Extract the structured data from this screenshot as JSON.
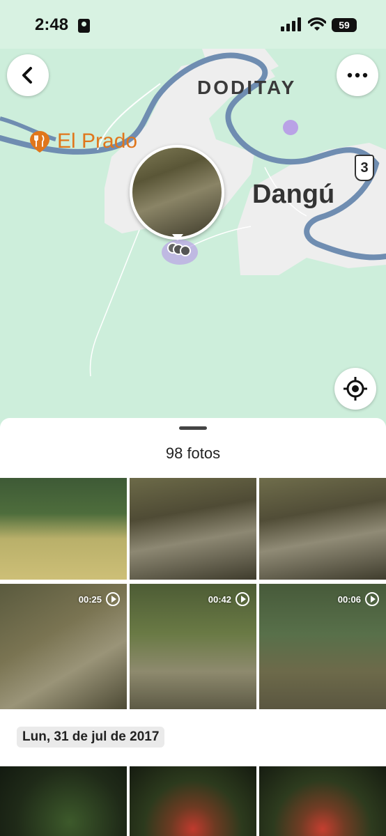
{
  "status_bar": {
    "time": "2:48",
    "battery": "59"
  },
  "map": {
    "labels": {
      "area_north": "DODITAY",
      "town": "Dangú",
      "poi": "El Prado",
      "route_number": "3"
    },
    "icons": {
      "back": "chevron-left-icon",
      "more": "more-horizontal-icon",
      "locate": "my-location-icon",
      "poi": "restaurant-icon"
    },
    "colors": {
      "land": "#cdeedb",
      "urban": "#eeeeee",
      "road": "#6f8db1",
      "poi": "#e0761b"
    }
  },
  "sheet": {
    "photo_count": "98 fotos",
    "rows": [
      [
        {
          "type": "photo"
        },
        {
          "type": "photo"
        },
        {
          "type": "photo"
        }
      ],
      [
        {
          "type": "video",
          "duration": "00:25"
        },
        {
          "type": "video",
          "duration": "00:42"
        },
        {
          "type": "video",
          "duration": "00:06"
        }
      ]
    ],
    "section_date": "Lun, 31 de jul de 2017"
  }
}
